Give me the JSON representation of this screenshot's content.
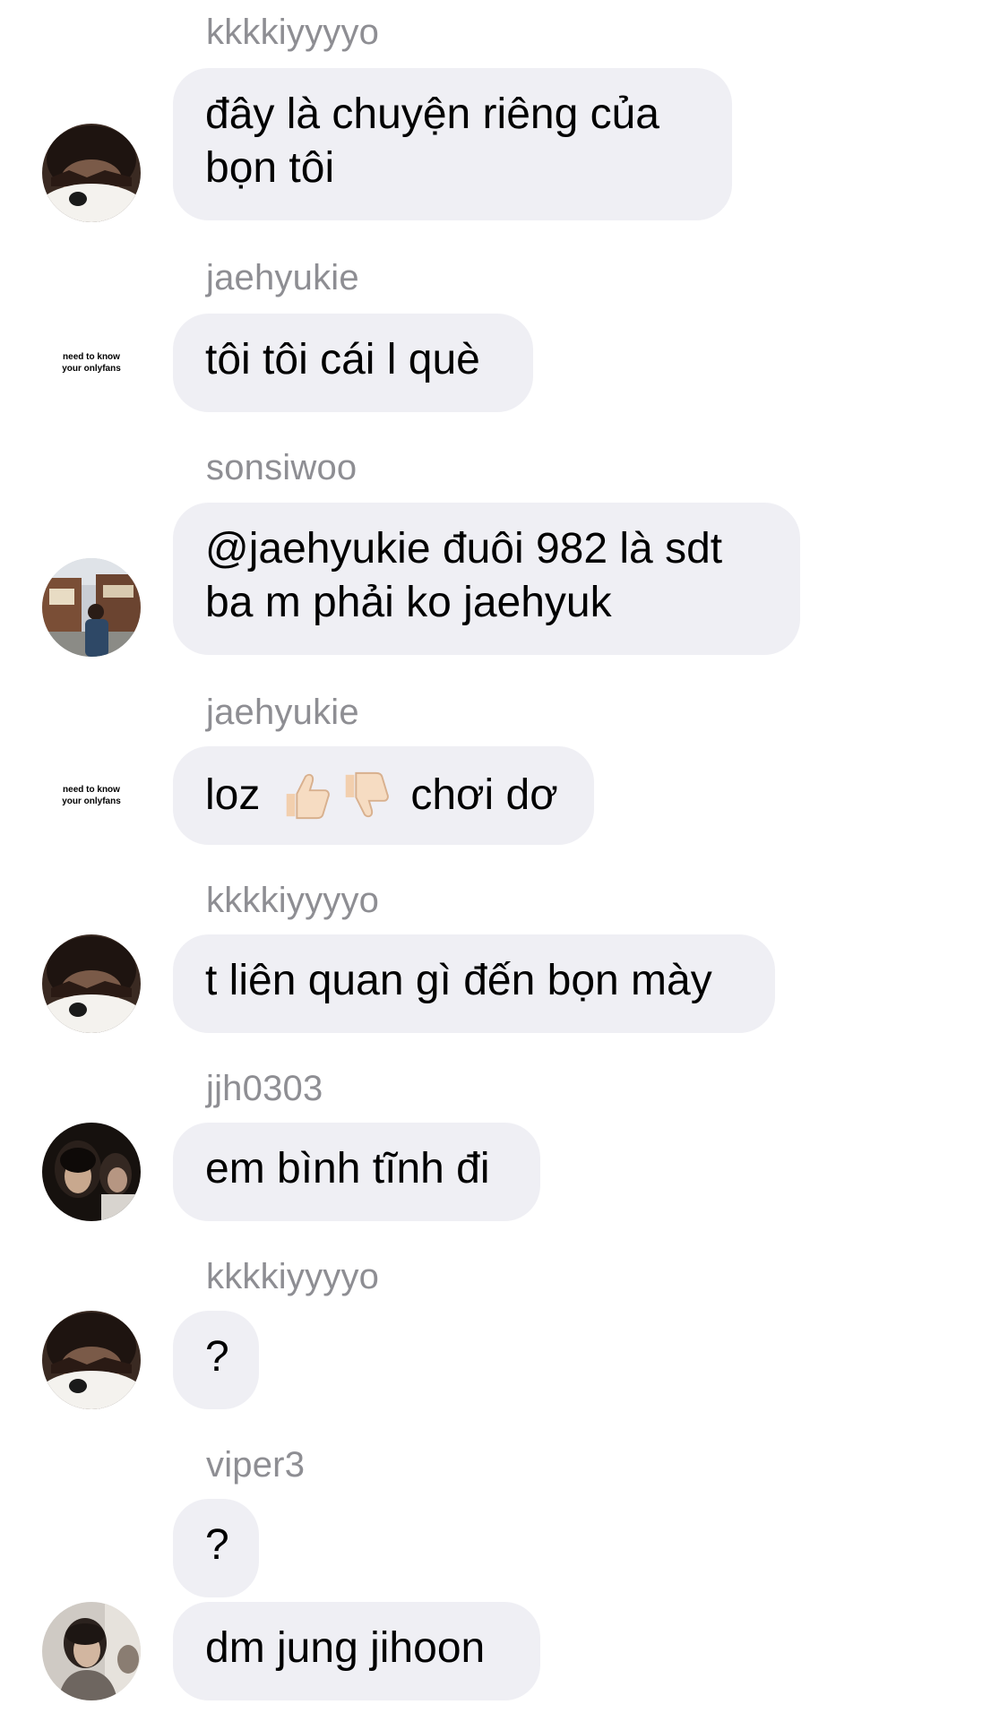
{
  "messages": [
    {
      "username": "kkkkiyyyyo",
      "text": "đây là chuyện riêng của\nbọn tôi",
      "avatar": "photo-dark-face"
    },
    {
      "username": "jaehyukie",
      "text": "tôi tôi cái l què",
      "avatar": "text-avatar"
    },
    {
      "username": "sonsiwoo",
      "text": "@jaehyukie đuôi 982 là sdt\nba m phải ko jaehyuk",
      "avatar": "photo-street"
    },
    {
      "username": "jaehyukie",
      "text_before": "loz",
      "text_after": "chơi dơ",
      "emojis": [
        "thumbs-up-icon",
        "thumbs-down-icon"
      ],
      "avatar": "text-avatar"
    },
    {
      "username": "kkkkiyyyyo",
      "text": "t liên quan gì đến bọn mày",
      "avatar": "photo-dark-face"
    },
    {
      "username": "jjh0303",
      "text": "em bình tĩnh đi",
      "avatar": "photo-two-people"
    },
    {
      "username": "kkkkiyyyyo",
      "text": "?",
      "avatar": "photo-dark-face"
    },
    {
      "username": "viper3",
      "text": "?",
      "text2": "dm jung jihoon",
      "avatar": "photo-person-gray"
    }
  ],
  "avatar_text": {
    "line1": "need to know",
    "line2": "your onlyfans"
  },
  "colors": {
    "bubble": "#efeff4",
    "username": "#8e8e93",
    "text": "#000000",
    "background": "#ffffff"
  }
}
